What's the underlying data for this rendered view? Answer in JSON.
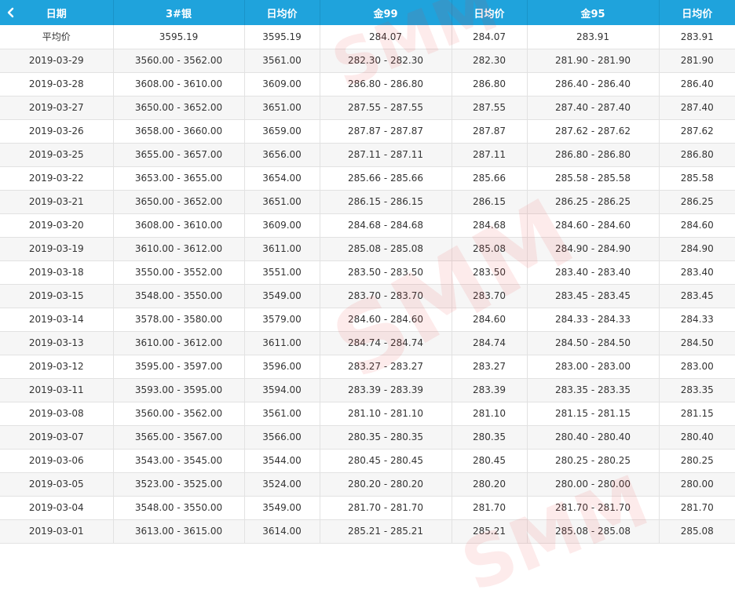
{
  "header": {
    "columns": [
      "日期",
      "3#银",
      "日均价",
      "金99",
      "日均价",
      "金95",
      "日均价"
    ]
  },
  "watermark": {
    "text": "SMM",
    "color": "#e83c3c"
  },
  "accent_color": "#1fa3dc",
  "rows": [
    [
      "平均价",
      "3595.19",
      "3595.19",
      "284.07",
      "284.07",
      "283.91",
      "283.91"
    ],
    [
      "2019-03-29",
      "3560.00 - 3562.00",
      "3561.00",
      "282.30 - 282.30",
      "282.30",
      "281.90 - 281.90",
      "281.90"
    ],
    [
      "2019-03-28",
      "3608.00 - 3610.00",
      "3609.00",
      "286.80 - 286.80",
      "286.80",
      "286.40 - 286.40",
      "286.40"
    ],
    [
      "2019-03-27",
      "3650.00 - 3652.00",
      "3651.00",
      "287.55 - 287.55",
      "287.55",
      "287.40 - 287.40",
      "287.40"
    ],
    [
      "2019-03-26",
      "3658.00 - 3660.00",
      "3659.00",
      "287.87 - 287.87",
      "287.87",
      "287.62 - 287.62",
      "287.62"
    ],
    [
      "2019-03-25",
      "3655.00 - 3657.00",
      "3656.00",
      "287.11 - 287.11",
      "287.11",
      "286.80 - 286.80",
      "286.80"
    ],
    [
      "2019-03-22",
      "3653.00 - 3655.00",
      "3654.00",
      "285.66 - 285.66",
      "285.66",
      "285.58 - 285.58",
      "285.58"
    ],
    [
      "2019-03-21",
      "3650.00 - 3652.00",
      "3651.00",
      "286.15 - 286.15",
      "286.15",
      "286.25 - 286.25",
      "286.25"
    ],
    [
      "2019-03-20",
      "3608.00 - 3610.00",
      "3609.00",
      "284.68 - 284.68",
      "284.68",
      "284.60 - 284.60",
      "284.60"
    ],
    [
      "2019-03-19",
      "3610.00 - 3612.00",
      "3611.00",
      "285.08 - 285.08",
      "285.08",
      "284.90 - 284.90",
      "284.90"
    ],
    [
      "2019-03-18",
      "3550.00 - 3552.00",
      "3551.00",
      "283.50 - 283.50",
      "283.50",
      "283.40 - 283.40",
      "283.40"
    ],
    [
      "2019-03-15",
      "3548.00 - 3550.00",
      "3549.00",
      "283.70 - 283.70",
      "283.70",
      "283.45 - 283.45",
      "283.45"
    ],
    [
      "2019-03-14",
      "3578.00 - 3580.00",
      "3579.00",
      "284.60 - 284.60",
      "284.60",
      "284.33 - 284.33",
      "284.33"
    ],
    [
      "2019-03-13",
      "3610.00 - 3612.00",
      "3611.00",
      "284.74 - 284.74",
      "284.74",
      "284.50 - 284.50",
      "284.50"
    ],
    [
      "2019-03-12",
      "3595.00 - 3597.00",
      "3596.00",
      "283.27 - 283.27",
      "283.27",
      "283.00 - 283.00",
      "283.00"
    ],
    [
      "2019-03-11",
      "3593.00 - 3595.00",
      "3594.00",
      "283.39 - 283.39",
      "283.39",
      "283.35 - 283.35",
      "283.35"
    ],
    [
      "2019-03-08",
      "3560.00 - 3562.00",
      "3561.00",
      "281.10 - 281.10",
      "281.10",
      "281.15 - 281.15",
      "281.15"
    ],
    [
      "2019-03-07",
      "3565.00 - 3567.00",
      "3566.00",
      "280.35 - 280.35",
      "280.35",
      "280.40 - 280.40",
      "280.40"
    ],
    [
      "2019-03-06",
      "3543.00 - 3545.00",
      "3544.00",
      "280.45 - 280.45",
      "280.45",
      "280.25 - 280.25",
      "280.25"
    ],
    [
      "2019-03-05",
      "3523.00 - 3525.00",
      "3524.00",
      "280.20 - 280.20",
      "280.20",
      "280.00 - 280.00",
      "280.00"
    ],
    [
      "2019-03-04",
      "3548.00 - 3550.00",
      "3549.00",
      "281.70 - 281.70",
      "281.70",
      "281.70 - 281.70",
      "281.70"
    ],
    [
      "2019-03-01",
      "3613.00 - 3615.00",
      "3614.00",
      "285.21 - 285.21",
      "285.21",
      "285.08 - 285.08",
      "285.08"
    ]
  ]
}
